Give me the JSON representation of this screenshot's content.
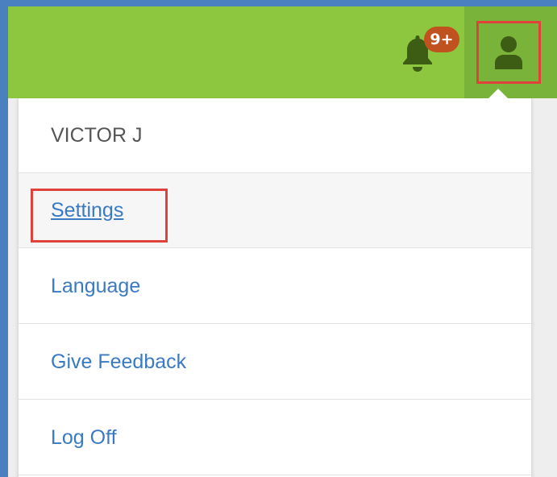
{
  "header": {
    "notification_badge": "9+",
    "bell_icon": "bell-icon",
    "user_icon": "user-icon"
  },
  "menu": {
    "user_name": "VICTOR J",
    "items": [
      {
        "label": "Settings"
      },
      {
        "label": "Language"
      },
      {
        "label": "Give Feedback"
      },
      {
        "label": "Log Off"
      }
    ]
  },
  "colors": {
    "topbar": "#8dc63f",
    "user_tab": "#7ab33a",
    "icon": "#3d5c14",
    "badge": "#c0521f",
    "link": "#3a7ac4",
    "highlight": "#e0413a"
  }
}
